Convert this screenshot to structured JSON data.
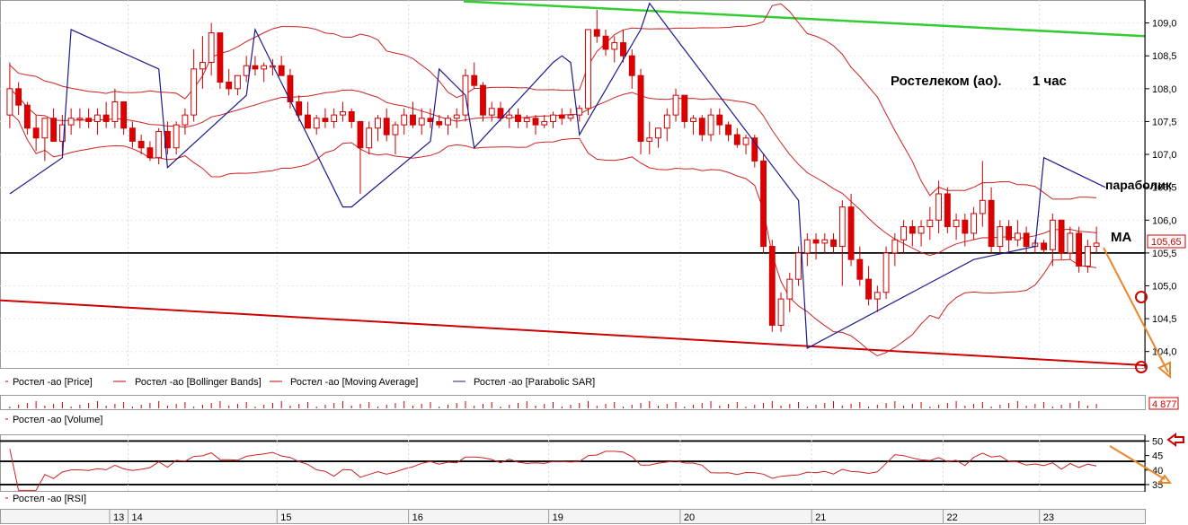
{
  "chart_data": {
    "type": "candlestick",
    "price_panel": {
      "ylim": [
        103.75,
        109.35
      ],
      "y_ticks": [
        "109,0",
        "108,5",
        "108,0",
        "107,5",
        "107,0",
        "106,5",
        "106,0",
        "105,5",
        "105,0",
        "104,5",
        "104,0"
      ],
      "current_price_label": "105,65",
      "annotations": {
        "title": "Ростелеком (ао).",
        "timeframe": "1 час",
        "sar_label": "параболик",
        "ma_label": "МА"
      },
      "legend": [
        {
          "name": "Ростел -ао [Price]",
          "color": "#cc0000"
        },
        {
          "name": "Ростел -ао [Bollinger Bands]",
          "color": "#cc0000"
        },
        {
          "name": "Ростел -ао [Moving Average]",
          "color": "#cc0000"
        },
        {
          "name": "Ростел -ао [Parabolic SAR]",
          "color": "#1a1a8c"
        }
      ],
      "horizontal_level": 105.5,
      "candles": [
        [
          107.6,
          108.4,
          107.4,
          108.0
        ],
        [
          108.0,
          108.1,
          107.6,
          107.75
        ],
        [
          107.75,
          107.8,
          107.3,
          107.4
        ],
        [
          107.4,
          107.6,
          107.05,
          107.25
        ],
        [
          107.25,
          107.55,
          106.9,
          107.55
        ],
        [
          107.55,
          107.7,
          107.2,
          107.2
        ],
        [
          107.2,
          107.6,
          107.0,
          107.45
        ],
        [
          107.45,
          107.7,
          107.3,
          107.55
        ],
        [
          107.55,
          107.7,
          107.4,
          107.55
        ],
        [
          107.55,
          107.7,
          107.4,
          107.5
        ],
        [
          107.5,
          107.7,
          107.3,
          107.6
        ],
        [
          107.6,
          107.8,
          107.4,
          107.5
        ],
        [
          107.5,
          108.0,
          107.4,
          107.8
        ],
        [
          107.8,
          107.8,
          107.3,
          107.4
        ],
        [
          107.4,
          107.5,
          107.1,
          107.2
        ],
        [
          107.2,
          107.3,
          107.0,
          107.1
        ],
        [
          107.1,
          107.2,
          106.9,
          106.95
        ],
        [
          106.95,
          107.4,
          106.85,
          107.35
        ],
        [
          107.35,
          107.5,
          107.0,
          107.1
        ],
        [
          107.1,
          107.5,
          107.0,
          107.45
        ],
        [
          107.45,
          107.7,
          107.3,
          107.6
        ],
        [
          107.6,
          108.6,
          107.5,
          108.3
        ],
        [
          108.3,
          108.8,
          108.0,
          108.4
        ],
        [
          108.4,
          109.0,
          108.2,
          108.85
        ],
        [
          108.85,
          108.85,
          108.0,
          108.1
        ],
        [
          108.1,
          108.3,
          107.9,
          108.0
        ],
        [
          108.0,
          108.2,
          107.9,
          108.2
        ],
        [
          108.2,
          108.5,
          108.1,
          108.35
        ],
        [
          108.35,
          108.5,
          108.2,
          108.3
        ],
        [
          108.3,
          108.4,
          108.1,
          108.35
        ],
        [
          108.35,
          108.45,
          108.2,
          108.35
        ],
        [
          108.35,
          108.5,
          108.2,
          108.2
        ],
        [
          108.2,
          108.3,
          107.7,
          107.8
        ],
        [
          107.8,
          107.9,
          107.5,
          107.6
        ],
        [
          107.6,
          107.8,
          107.4,
          107.4
        ],
        [
          107.4,
          107.6,
          107.3,
          107.55
        ],
        [
          107.55,
          107.7,
          107.4,
          107.5
        ],
        [
          107.5,
          107.7,
          107.4,
          107.6
        ],
        [
          107.6,
          107.8,
          107.5,
          107.65
        ],
        [
          107.65,
          107.7,
          107.4,
          107.5
        ],
        [
          107.5,
          107.5,
          106.4,
          107.1
        ],
        [
          107.1,
          107.5,
          107.0,
          107.4
        ],
        [
          107.4,
          107.6,
          107.2,
          107.55
        ],
        [
          107.55,
          107.7,
          107.2,
          107.3
        ],
        [
          107.3,
          107.5,
          107.0,
          107.45
        ],
        [
          107.45,
          107.7,
          107.3,
          107.6
        ],
        [
          107.6,
          107.8,
          107.4,
          107.45
        ],
        [
          107.45,
          107.7,
          107.3,
          107.55
        ],
        [
          107.55,
          107.7,
          107.4,
          107.5
        ],
        [
          107.5,
          107.6,
          107.4,
          107.45
        ],
        [
          107.45,
          107.6,
          107.3,
          107.55
        ],
        [
          107.55,
          107.7,
          107.4,
          107.6
        ],
        [
          107.6,
          108.3,
          107.5,
          108.2
        ],
        [
          108.2,
          108.4,
          108.0,
          108.05
        ],
        [
          108.05,
          108.1,
          107.5,
          107.6
        ],
        [
          107.6,
          107.8,
          107.5,
          107.7
        ],
        [
          107.7,
          107.8,
          107.5,
          107.55
        ],
        [
          107.55,
          107.7,
          107.4,
          107.6
        ],
        [
          107.6,
          107.7,
          107.4,
          107.5
        ],
        [
          107.5,
          107.6,
          107.4,
          107.55
        ],
        [
          107.55,
          107.6,
          107.3,
          107.45
        ],
        [
          107.45,
          107.6,
          107.4,
          107.5
        ],
        [
          107.5,
          107.65,
          107.4,
          107.6
        ],
        [
          107.6,
          107.7,
          107.45,
          107.55
        ],
        [
          107.55,
          107.7,
          107.5,
          107.6
        ],
        [
          107.6,
          107.75,
          107.5,
          107.7
        ],
        [
          107.7,
          108.6,
          107.6,
          108.9
        ],
        [
          108.9,
          109.2,
          108.7,
          108.8
        ],
        [
          108.8,
          108.9,
          108.5,
          108.6
        ],
        [
          108.6,
          108.8,
          108.4,
          108.7
        ],
        [
          108.7,
          108.9,
          108.4,
          108.5
        ],
        [
          108.5,
          108.6,
          108.0,
          108.2
        ],
        [
          108.2,
          108.3,
          107.0,
          107.2
        ],
        [
          107.2,
          107.5,
          107.0,
          107.25
        ],
        [
          107.25,
          107.4,
          107.1,
          107.4
        ],
        [
          107.4,
          107.7,
          107.2,
          107.6
        ],
        [
          107.6,
          108.0,
          107.5,
          107.9
        ],
        [
          107.9,
          107.9,
          107.4,
          107.5
        ],
        [
          107.5,
          107.6,
          107.3,
          107.55
        ],
        [
          107.55,
          107.6,
          107.2,
          107.3
        ],
        [
          107.3,
          107.7,
          107.2,
          107.6
        ],
        [
          107.6,
          107.7,
          107.3,
          107.45
        ],
        [
          107.45,
          107.5,
          107.2,
          107.3
        ],
        [
          107.3,
          107.4,
          107.1,
          107.15
        ],
        [
          107.15,
          107.3,
          107.0,
          107.25
        ],
        [
          107.25,
          107.3,
          106.8,
          106.9
        ],
        [
          106.9,
          107.0,
          105.5,
          105.6
        ],
        [
          105.6,
          105.7,
          104.3,
          104.4
        ],
        [
          104.4,
          104.9,
          104.3,
          104.8
        ],
        [
          104.8,
          105.2,
          104.6,
          105.1
        ],
        [
          105.1,
          105.6,
          105.0,
          105.5
        ],
        [
          105.5,
          105.8,
          105.3,
          105.7
        ],
        [
          105.7,
          105.8,
          105.4,
          105.65
        ],
        [
          105.65,
          105.8,
          105.5,
          105.7
        ],
        [
          105.7,
          105.8,
          105.5,
          105.6
        ],
        [
          105.6,
          106.3,
          105.0,
          106.2
        ],
        [
          106.2,
          106.4,
          105.3,
          105.4
        ],
        [
          105.4,
          105.6,
          105.0,
          105.1
        ],
        [
          105.1,
          105.3,
          104.7,
          104.8
        ],
        [
          104.8,
          105.0,
          104.6,
          104.9
        ],
        [
          104.9,
          105.6,
          104.8,
          105.5
        ],
        [
          105.5,
          105.8,
          105.3,
          105.7
        ],
        [
          105.7,
          106.0,
          105.5,
          105.9
        ],
        [
          105.9,
          106.0,
          105.6,
          105.8
        ],
        [
          105.8,
          106.0,
          105.6,
          105.9
        ],
        [
          105.9,
          106.2,
          105.7,
          106.0
        ],
        [
          106.0,
          106.6,
          105.8,
          106.4
        ],
        [
          106.4,
          106.5,
          105.8,
          105.9
        ],
        [
          105.9,
          106.1,
          105.7,
          106.0
        ],
        [
          106.0,
          106.1,
          105.6,
          105.8
        ],
        [
          105.8,
          106.2,
          105.7,
          106.1
        ],
        [
          106.1,
          106.9,
          105.9,
          106.3
        ],
        [
          106.3,
          106.5,
          105.5,
          105.6
        ],
        [
          105.6,
          106.0,
          105.5,
          105.9
        ],
        [
          105.9,
          106.0,
          105.5,
          105.7
        ],
        [
          105.7,
          106.0,
          105.6,
          105.8
        ],
        [
          105.8,
          105.9,
          105.5,
          105.6
        ],
        [
          105.6,
          105.7,
          105.5,
          105.65
        ],
        [
          105.65,
          105.7,
          105.5,
          105.55
        ],
        [
          105.55,
          106.1,
          105.3,
          106.0
        ],
        [
          106.0,
          106.0,
          105.4,
          105.5
        ],
        [
          105.5,
          105.9,
          105.4,
          105.8
        ],
        [
          105.8,
          105.9,
          105.2,
          105.3
        ],
        [
          105.3,
          105.7,
          105.2,
          105.6
        ],
        [
          105.6,
          105.9,
          105.5,
          105.65
        ]
      ],
      "parabolic_sar": [
        [
          0,
          106.4
        ],
        [
          6,
          106.95
        ],
        [
          7,
          108.9
        ],
        [
          17,
          108.3
        ],
        [
          18,
          106.8
        ],
        [
          27,
          107.9
        ],
        [
          28,
          108.9
        ],
        [
          38,
          106.2
        ],
        [
          39,
          106.2
        ],
        [
          48,
          107.2
        ],
        [
          49,
          108.3
        ],
        [
          52,
          107.9
        ],
        [
          53,
          107.1
        ],
        [
          62,
          108.4
        ],
        [
          63,
          108.5
        ],
        [
          64,
          108.4
        ],
        [
          65,
          107.3
        ],
        [
          72,
          108.9
        ],
        [
          73,
          109.3
        ],
        [
          90,
          106.3
        ],
        [
          91,
          104.05
        ],
        [
          110,
          105.4
        ],
        [
          117,
          105.6
        ],
        [
          118,
          106.95
        ],
        [
          125,
          106.5
        ]
      ]
    },
    "volume_panel": {
      "label": "Ростел -ао [Volume]",
      "last_value_label": "4 877"
    },
    "rsi_panel": {
      "label": "Ростел -ао [RSI]",
      "y_ticks": [
        "50",
        "45",
        "40",
        "35"
      ],
      "levels": [
        50,
        43
      ],
      "ylim": [
        32.5,
        52
      ]
    },
    "x_axis": {
      "labels": [
        "13",
        "14",
        "15",
        "16",
        "19",
        "20",
        "21",
        "22",
        "23"
      ]
    }
  }
}
